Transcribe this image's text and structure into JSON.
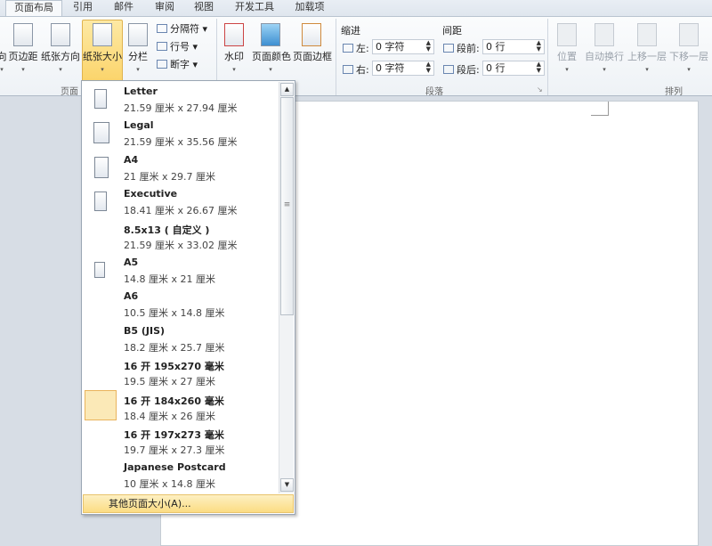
{
  "tabs": [
    "页面布局",
    "引用",
    "邮件",
    "审阅",
    "视图",
    "开发工具",
    "加载项"
  ],
  "ribbon": {
    "page_setup": {
      "label": "页面",
      "cut_button": "向",
      "margins": "页边距",
      "orientation": "纸张方向",
      "size": "纸张大小",
      "columns": "分栏",
      "breaks": "分隔符",
      "line_numbers": "行号",
      "hyphenation": "断字"
    },
    "background": {
      "watermark": "水印",
      "page_color": "页面颜色",
      "page_borders": "页面边框"
    },
    "paragraph": {
      "label": "段落",
      "indent_label": "缩进",
      "left_label": "左:",
      "left_value": "0 字符",
      "right_label": "右:",
      "right_value": "0 字符",
      "spacing_label": "间距",
      "before_label": "段前:",
      "before_value": "0 行",
      "after_label": "段后:",
      "after_value": "0 行"
    },
    "arrange": {
      "label": "排列",
      "position": "位置",
      "wrap": "自动换行",
      "forward": "上移一层",
      "backward": "下移一层"
    }
  },
  "menu": {
    "items": [
      {
        "name": "Letter",
        "dims": "21.59 厘米 x 27.94 厘米"
      },
      {
        "name": "Legal",
        "dims": "21.59 厘米 x 35.56 厘米"
      },
      {
        "name": "A4",
        "dims": "21 厘米 x 29.7 厘米"
      },
      {
        "name": "Executive",
        "dims": "18.41 厘米 x 26.67 厘米"
      },
      {
        "name": "8.5x13 ( 自定义 )",
        "dims": "21.59 厘米 x 33.02 厘米"
      },
      {
        "name": "A5",
        "dims": "14.8 厘米 x 21 厘米"
      },
      {
        "name": "A6",
        "dims": "10.5 厘米 x 14.8 厘米"
      },
      {
        "name": "B5 (JIS)",
        "dims": "18.2 厘米 x 25.7 厘米"
      },
      {
        "name": "16 开 195x270 毫米",
        "dims": "19.5 厘米 x 27 厘米"
      },
      {
        "name": "16 开 184x260 毫米",
        "dims": "18.4 厘米 x 26 厘米"
      },
      {
        "name": "16 开 197x273 毫米",
        "dims": "19.7 厘米 x 27.3 厘米"
      },
      {
        "name": "Japanese Postcard",
        "dims": "10 厘米 x 14.8 厘米"
      }
    ],
    "selected_index": 9,
    "more": "其他页面大小(A)..."
  }
}
